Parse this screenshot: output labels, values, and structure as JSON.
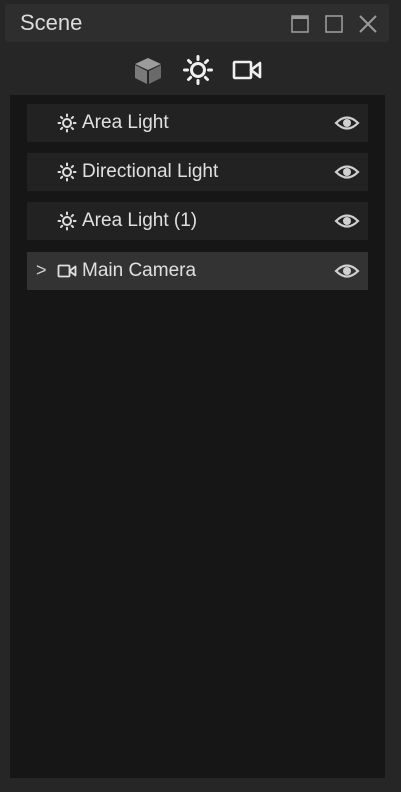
{
  "window": {
    "title": "Scene",
    "controls": [
      "minimize-icon",
      "maximize-icon",
      "close-icon"
    ]
  },
  "filters": [
    {
      "name": "objects",
      "icon": "cube-icon",
      "active": false
    },
    {
      "name": "lights",
      "icon": "sun-icon",
      "active": true
    },
    {
      "name": "cameras",
      "icon": "video-camera-icon",
      "active": true
    }
  ],
  "items": [
    {
      "label": "Area Light",
      "icon": "sun-icon",
      "expandable": false,
      "visible": true
    },
    {
      "label": "Directional Light",
      "icon": "sun-icon",
      "expandable": false,
      "visible": true
    },
    {
      "label": "Area Light (1)",
      "icon": "sun-icon",
      "expandable": false,
      "visible": true
    },
    {
      "label": "Main Camera",
      "icon": "video-camera-icon",
      "expandable": true,
      "expander": ">",
      "visible": true
    }
  ],
  "colors": {
    "panel": "#262626",
    "list_background": "#161616",
    "row": "#222222",
    "row_selected": "#333333",
    "text": "#e0e0e0"
  }
}
